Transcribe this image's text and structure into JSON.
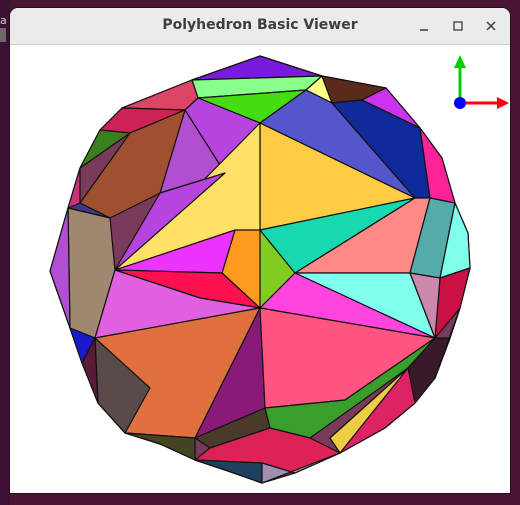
{
  "desktop": {
    "left_edge_text": "ar"
  },
  "window": {
    "title": "Polyhedron Basic Viewer",
    "controls": [
      {
        "name": "minimize-button",
        "icon": "minimize-icon"
      },
      {
        "name": "maximize-button",
        "icon": "maximize-icon"
      },
      {
        "name": "close-button",
        "icon": "close-icon"
      }
    ]
  },
  "axis_gizmo": {
    "x_color": "#ff0000",
    "y_color": "#00cc00",
    "z_color": "#0000ff"
  },
  "polyhedron": {
    "type": "snub-polyhedron",
    "face_colors": [
      "#ffcc44",
      "#ffe066",
      "#b844e0",
      "#5555cc",
      "#3a9e2a",
      "#ff5580",
      "#e07040",
      "#18d8b0",
      "#ff8888",
      "#80ffea",
      "#e060e0",
      "#ff1050",
      "#ff9920",
      "#80cc20",
      "#a05030",
      "#6a1a50"
    ]
  }
}
